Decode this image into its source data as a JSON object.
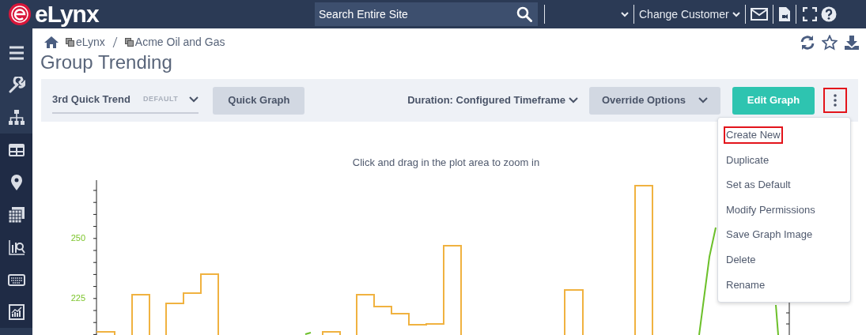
{
  "header": {
    "logo_text": "eLynx",
    "search": {
      "placeholder": "Search Entire Site"
    },
    "customer_menu": "Change Customer"
  },
  "sidebar": {
    "items": [
      {
        "kind": "menu",
        "selected": false
      },
      {
        "kind": "wrench",
        "selected": false
      },
      {
        "kind": "sitemap",
        "selected": false
      },
      {
        "kind": "table",
        "selected": false
      },
      {
        "kind": "pin",
        "selected": false
      },
      {
        "kind": "calendar",
        "selected": false
      },
      {
        "kind": "analysis",
        "selected": false
      },
      {
        "kind": "keyboard",
        "selected": false
      },
      {
        "kind": "chart",
        "selected": false
      }
    ]
  },
  "breadcrumb": [
    "eLynx",
    "Acme Oil and Gas"
  ],
  "page_title": "Group Trending",
  "toolbar": {
    "trend_name": "3rd Quick Trend",
    "trend_tag": "DEFAULT",
    "quick_graph": "Quick Graph",
    "duration_label": "Duration:",
    "duration_value": "Configured Timeframe",
    "override": "Override Options",
    "edit": "Edit Graph",
    "more_highlighted": true
  },
  "chart": {
    "hint": "Click and drag in the plot area to zoom in",
    "y_labels": [
      "250",
      "225"
    ]
  },
  "menu": [
    {
      "label": "Create New",
      "highlighted": true
    },
    {
      "label": "Duplicate",
      "highlighted": false
    },
    {
      "label": "Set as Default",
      "highlighted": false
    },
    {
      "label": "Modify Permissions",
      "highlighted": false
    },
    {
      "label": "Save Graph Image",
      "highlighted": false
    },
    {
      "label": "Delete",
      "highlighted": false
    },
    {
      "label": "Rename",
      "highlighted": false
    }
  ]
}
